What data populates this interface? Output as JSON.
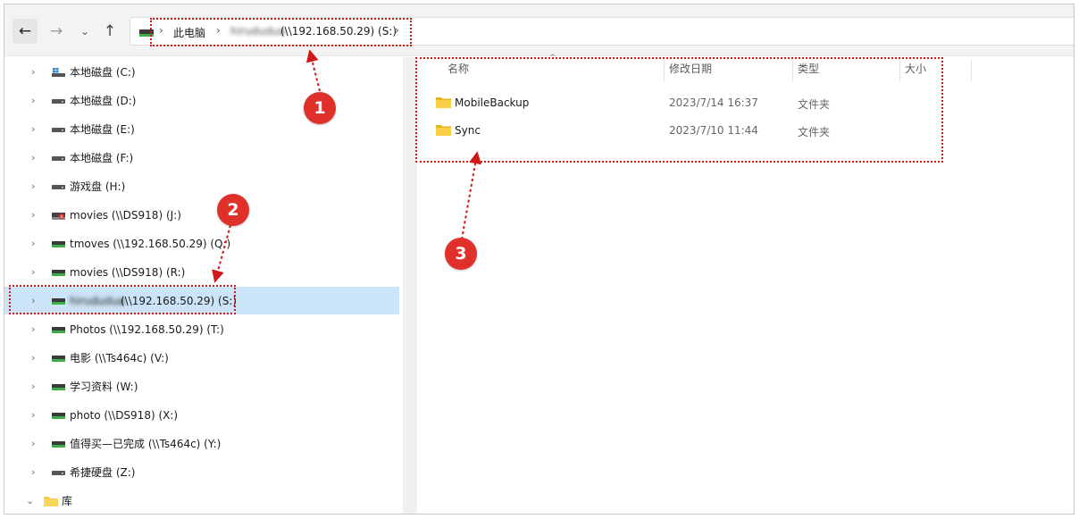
{
  "toolbar": {
    "back_icon": "←",
    "forward_icon": "→",
    "dropdown_icon": "⌄",
    "up_icon": "↑"
  },
  "address_bar": {
    "sep_icon": "›",
    "crumb_this_pc": "此电脑",
    "crumb_share_blurred": "hirududua",
    "crumb_share_path": "(\\\\192.168.50.29) (S:)"
  },
  "sidebar": {
    "items": [
      {
        "label": "本地磁盘 (C:)",
        "icon": "windows-drive-icon"
      },
      {
        "label": "本地磁盘 (D:)",
        "icon": "drive-icon"
      },
      {
        "label": "本地磁盘 (E:)",
        "icon": "drive-icon"
      },
      {
        "label": "本地磁盘 (F:)",
        "icon": "drive-icon"
      },
      {
        "label": "游戏盘 (H:)",
        "icon": "drive-icon"
      },
      {
        "label": "movies (\\\\DS918) (J:)",
        "icon": "network-drive-disconnected-icon"
      },
      {
        "label": "tmoves (\\\\192.168.50.29) (Q:)",
        "icon": "network-drive-icon"
      },
      {
        "label": "movies (\\\\DS918) (R:)",
        "icon": "network-drive-icon"
      },
      {
        "label_blurred": "hirududua",
        "label": "(\\\\192.168.50.29) (S:)",
        "icon": "network-drive-icon"
      },
      {
        "label": "Photos (\\\\192.168.50.29) (T:)",
        "icon": "network-drive-icon"
      },
      {
        "label": "电影 (\\\\Ts464c) (V:)",
        "icon": "network-drive-icon"
      },
      {
        "label": "学习资料 (W:)",
        "icon": "network-drive-icon"
      },
      {
        "label": "photo (\\\\DS918) (X:)",
        "icon": "network-drive-icon"
      },
      {
        "label": "值得买—已完成 (\\\\Ts464c) (Y:)",
        "icon": "network-drive-icon"
      },
      {
        "label": "希捷硬盘 (Z:)",
        "icon": "drive-icon"
      },
      {
        "label": "库",
        "icon": "library-folder-icon"
      }
    ],
    "chevron_right": "›",
    "chevron_down": "⌄"
  },
  "content": {
    "columns": {
      "name": "名称",
      "modified": "修改日期",
      "type": "类型",
      "size": "大小"
    },
    "sort_arrow": "^",
    "files": [
      {
        "name": "MobileBackup",
        "modified": "2023/7/14 16:37",
        "type": "文件夹"
      },
      {
        "name": "Sync",
        "modified": "2023/7/10 11:44",
        "type": "文件夹"
      }
    ]
  },
  "annotations": {
    "badge_1": "1",
    "badge_2": "2",
    "badge_3": "3"
  },
  "colors": {
    "annotation_red": "#d01818",
    "badge_red": "#e0302a",
    "selection_blue": "#cce4f7",
    "folder_yellow": "#f4c430",
    "network_drive_green": "#3fae4a"
  }
}
